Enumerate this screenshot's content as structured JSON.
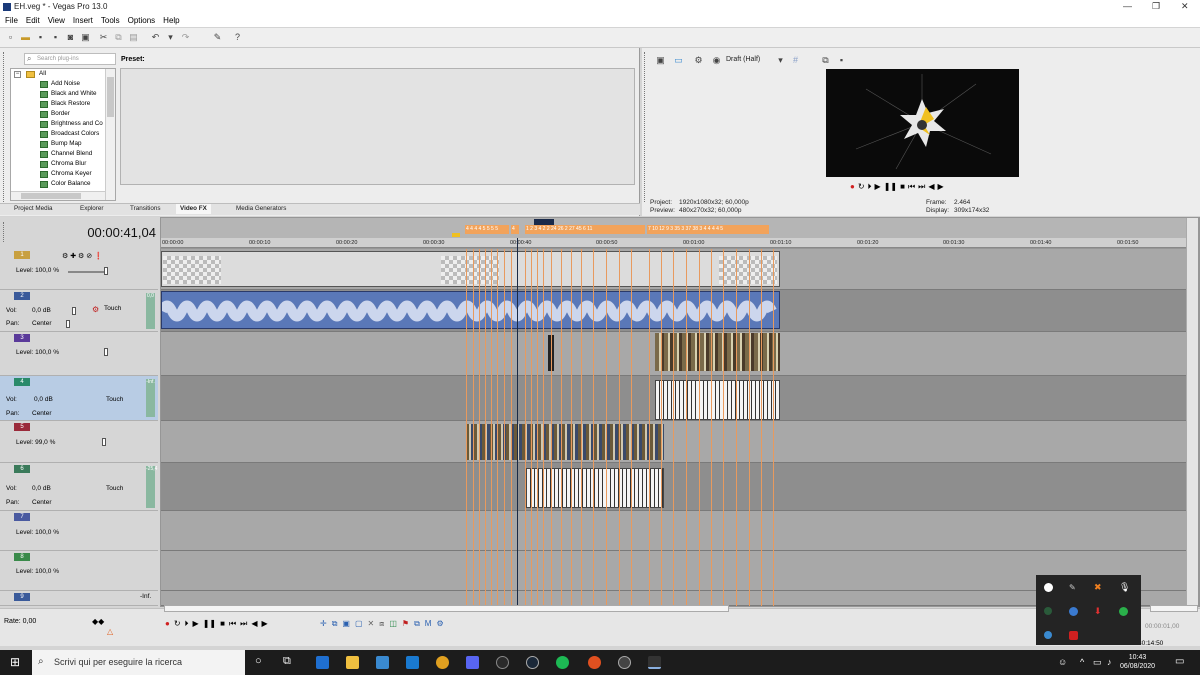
{
  "window": {
    "title": "EH.veg * - Vegas Pro 13.0"
  },
  "menu": [
    "File",
    "Edit",
    "View",
    "Insert",
    "Tools",
    "Options",
    "Help"
  ],
  "plugins": {
    "search_placeholder": "Search plug-ins",
    "preset_label": "Preset:",
    "items": [
      "All",
      "Add Noise",
      "Black and White",
      "Black Restore",
      "Border",
      "Brightness and Co",
      "Broadcast Colors",
      "Bump Map",
      "Channel Blend",
      "Chroma Blur",
      "Chroma Keyer",
      "Color Balance"
    ]
  },
  "left_tabs": [
    "Project Media",
    "Explorer",
    "Transitions",
    "Video FX",
    "Media Generators"
  ],
  "preview": {
    "quality": "Draft (Half)",
    "project_label": "Project:",
    "project_value": "1920x1080x32; 60,000p",
    "preview_label": "Preview:",
    "preview_value": "480x270x32; 60,000p",
    "frame_label": "Frame:",
    "frame_value": "2.464",
    "display_label": "Display:",
    "display_value": "309x174x32"
  },
  "timeline": {
    "timecode": "00:00:41,04",
    "ruler": [
      "00:00:00",
      "00:00:10",
      "00:00:20",
      "00:00:30",
      "00:00:40",
      "00:00:50",
      "00:01:00",
      "00:01:10",
      "00:01:20",
      "00:01:30",
      "00:01:40",
      "00:01:50"
    ],
    "end_time": "30:14:50"
  },
  "tracks": [
    {
      "num": "1",
      "type": "video",
      "level": "Level: 100,0 %",
      "color": "#c8a040"
    },
    {
      "num": "2",
      "type": "audio",
      "vol": "0,0 dB",
      "pan": "Center",
      "touch": "Touch",
      "meter": "0,0",
      "color": "#3a5a9a"
    },
    {
      "num": "3",
      "type": "video",
      "level": "Level: 100,0 %",
      "color": "#5a3a9a"
    },
    {
      "num": "4",
      "type": "audio",
      "vol": "0,0 dB",
      "pan": "Center",
      "touch": "Touch",
      "meter": "-Inf.",
      "color": "#2a8a6a"
    },
    {
      "num": "5",
      "type": "video",
      "level": "Level: 99,0 %",
      "color": "#9a2a3a"
    },
    {
      "num": "6",
      "type": "audio",
      "vol": "0,0 dB",
      "pan": "Center",
      "touch": "Touch",
      "meter": "-25,4",
      "color": "#3a7a5a"
    },
    {
      "num": "7",
      "type": "video",
      "level": "Level: 100,0 %",
      "color": "#4a5aa0"
    },
    {
      "num": "8",
      "type": "video",
      "level": "Level: 100,0 %",
      "color": "#3a8a4a"
    },
    {
      "num": "9",
      "type": "video",
      "level": "",
      "meter": "-Inf.",
      "color": "#3a5a9a"
    }
  ],
  "labels": {
    "vol": "Vol:",
    "pan": "Pan:",
    "meter_scale": "18\n36\n54\n72"
  },
  "rate": "Rate: 0,00",
  "status_time": "00:00:01,00",
  "taskbar": {
    "search": "Scrivi qui per eseguire la ricerca",
    "time": "10:43",
    "date": "06/08/2020"
  }
}
